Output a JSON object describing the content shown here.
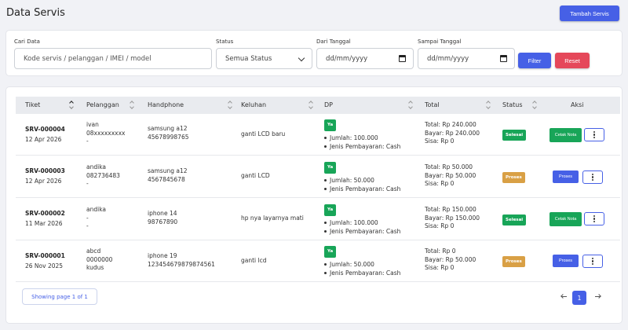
{
  "page": {
    "title": "Data Servis",
    "add_button": "Tambah Servis"
  },
  "filter": {
    "search_label": "Cari Data",
    "search_placeholder": "Kode servis / pelanggan / IMEI / model",
    "status_label": "Status",
    "status_value": "Semua Status",
    "from_label": "Dari Tanggal",
    "from_placeholder": "dd/mm/yyyy",
    "to_label": "Sampai Tanggal",
    "to_placeholder": "dd/mm/yyyy",
    "filter_button": "Filter",
    "reset_button": "Reset"
  },
  "table": {
    "headers": [
      "Tiket",
      "Pelanggan",
      "Handphone",
      "Keluhan",
      "DP",
      "Total",
      "Status",
      "Aksi"
    ],
    "rows": [
      {
        "ticket": "SRV-000004",
        "date": "12 Apr 2026",
        "customer": [
          "ivan",
          "08xxxxxxxxx",
          "-"
        ],
        "phone": [
          "samsung a12",
          "45678998765"
        ],
        "complaint": "ganti LCD baru",
        "dp_badge": "Ya",
        "dp_amount": "Jumlah: 100.000",
        "dp_method": "Jenis Pembayaran: Cash",
        "total": "Total: Rp 240.000",
        "paid": "Bayar: Rp 240.000",
        "rest": "Sisa: Rp 0",
        "status": "Selesai",
        "action": "Cetak Nota"
      },
      {
        "ticket": "SRV-000003",
        "date": "12 Apr 2026",
        "customer": [
          "andika",
          "082736483",
          "-"
        ],
        "phone": [
          "samsung a12",
          "4567845678"
        ],
        "complaint": "ganti LCD",
        "dp_badge": "Ya",
        "dp_amount": "Jumlah: 50.000",
        "dp_method": "Jenis Pembayaran: Cash",
        "total": "Total: Rp 50.000",
        "paid": "Bayar: Rp 50.000",
        "rest": "Sisa: Rp 0",
        "status": "Proses",
        "action": "Proses"
      },
      {
        "ticket": "SRV-000002",
        "date": "11 Mar 2026",
        "customer": [
          "andika",
          "-",
          "-"
        ],
        "phone": [
          "iphone 14",
          "98767890"
        ],
        "complaint": "hp nya layarnya mati",
        "dp_badge": "Ya",
        "dp_amount": "Jumlah: 100.000",
        "dp_method": "Jenis Pembayaran: Cash",
        "total": "Total: Rp 150.000",
        "paid": "Bayar: Rp 150.000",
        "rest": "Sisa: Rp 0",
        "status": "Selesai",
        "action": "Cetak Nota"
      },
      {
        "ticket": "SRV-000001",
        "date": "26 Nov 2025",
        "customer": [
          "abcd",
          "0000000",
          "kudus"
        ],
        "phone": [
          "iphone 19",
          "123454679879874561"
        ],
        "complaint": "ganti lcd",
        "dp_badge": "Ya",
        "dp_amount": "Jumlah: 50.000",
        "dp_method": "Jenis Pembayaran: Cash",
        "total": "Total: Rp 0",
        "paid": "Bayar: Rp 50.000",
        "rest": "Sisa: Rp 0",
        "status": "Proses",
        "action": "Proses"
      }
    ]
  },
  "pagination": {
    "showing": "Showing page 1 of 1",
    "current": "1"
  },
  "colors": {
    "primary": "#4660e6",
    "danger": "#e5485a",
    "success": "#18a558",
    "warning": "#d9a045"
  },
  "icons": {
    "menu": "kebab-icon",
    "calendar": "calendar-icon",
    "sort": "sort-icon"
  }
}
